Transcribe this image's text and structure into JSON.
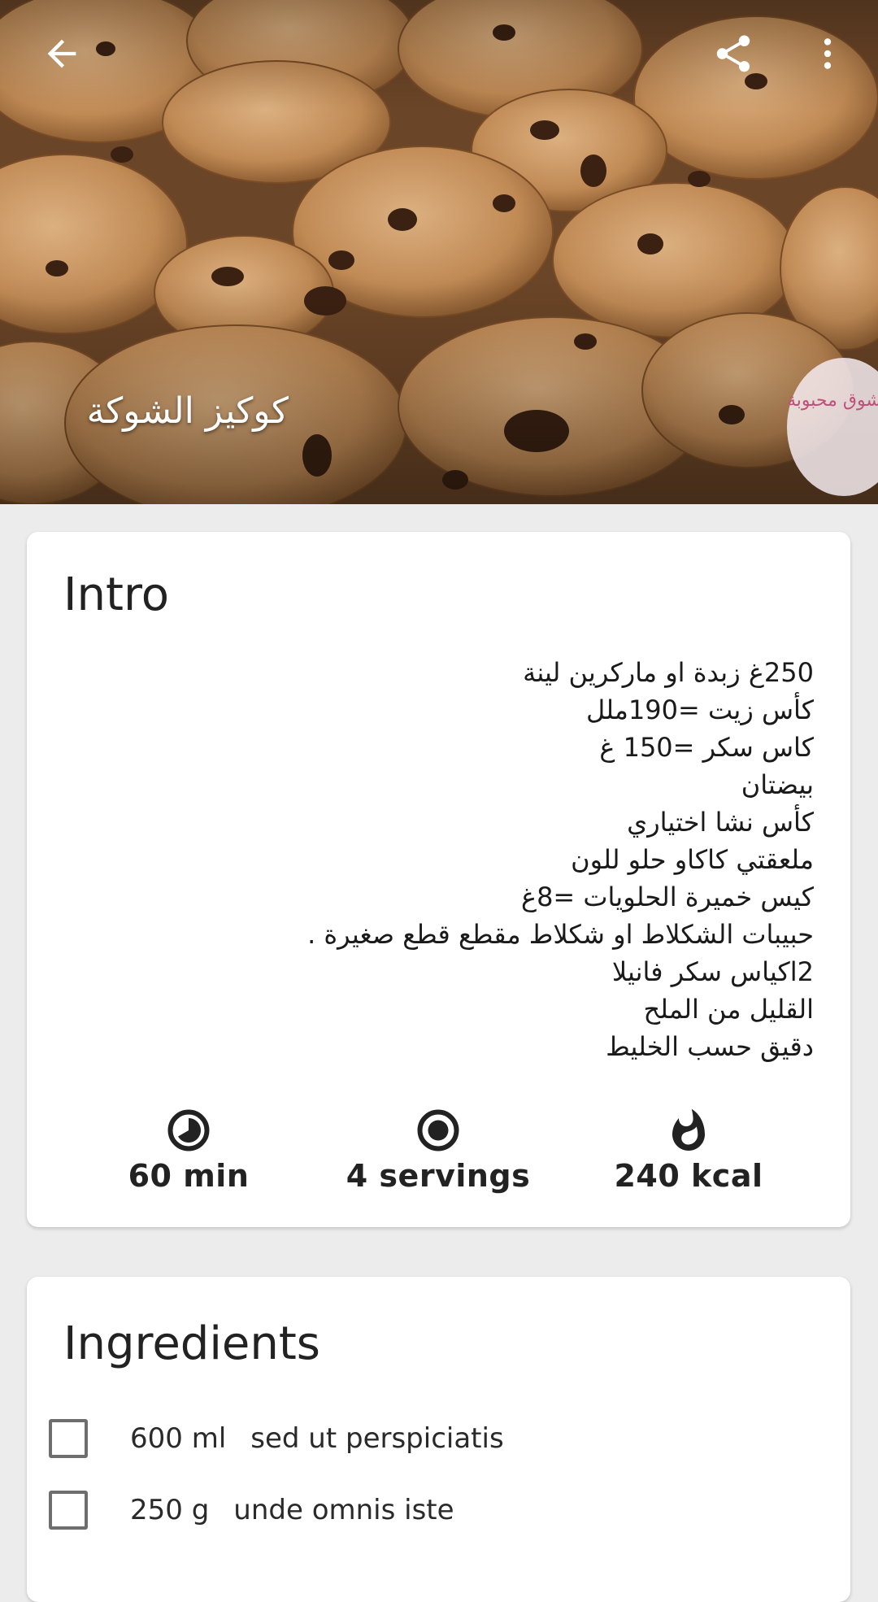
{
  "recipe": {
    "title": "كوكيز الشوكة",
    "watermark": "شوق محبوبة"
  },
  "toolbar": {
    "back_icon": "arrow-back-icon",
    "share_icon": "share-icon",
    "more_icon": "more-vert-icon"
  },
  "intro": {
    "heading": "Intro",
    "lines": [
      "250غ زبدة او ماركرين لينة",
      "كأس زيت =190ملل",
      "كاس سكر =150 غ",
      "بيضتان",
      "كأس نشا اختياري",
      "ملعقتي كاكاو حلو للون",
      "كيس خميرة الحلويات =8غ",
      "حبيبات الشكلاط او شكلاط مقطع قطع صغيرة .",
      "2اكياس سكر فانيلا",
      "القليل من الملح",
      "دقيق حسب الخليط"
    ],
    "stats": {
      "time": "60 min",
      "servings": "4 servings",
      "kcal": "240 kcal"
    }
  },
  "ingredients": {
    "heading": "Ingredients",
    "items": [
      {
        "qty": "600 ml",
        "name": "sed ut perspiciatis",
        "checked": false
      },
      {
        "qty": "250 g",
        "name": "unde omnis iste",
        "checked": false
      }
    ]
  },
  "colors": {
    "background": "#ececec",
    "card": "#ffffff",
    "text": "#222222",
    "checkbox_border": "#6e6e6e"
  }
}
